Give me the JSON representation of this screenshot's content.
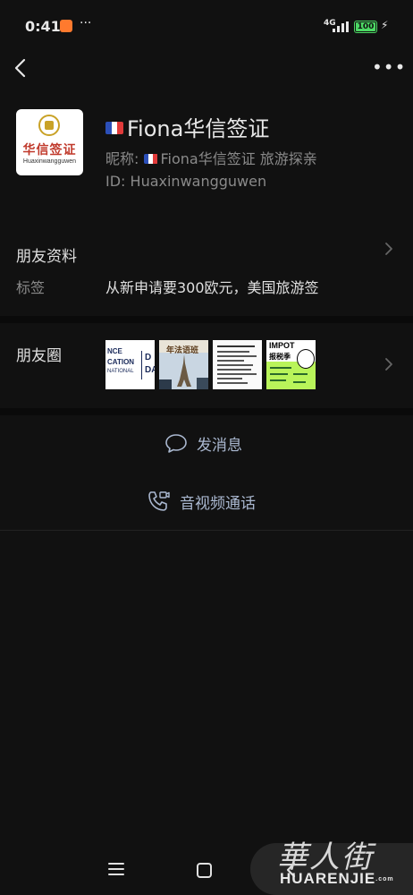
{
  "status_bar": {
    "time": "0:41",
    "dots": "···",
    "network": "4G",
    "battery": "100"
  },
  "profile": {
    "name": "Fiona华信签证",
    "nickname_label": "昵称:",
    "nickname": "Fiona华信签证 旅游探亲",
    "id_label": "ID:",
    "id_value": "Huaxinwangguwen",
    "avatar_title": "华信签证",
    "avatar_subtitle": "Huaxinwangguwen"
  },
  "friend_info": {
    "label": "朋友资料",
    "tag_label": "标签",
    "tag_value": "从新申请要300欧元，美国旅游签"
  },
  "moments": {
    "label": "朋友圈",
    "thumb1_lines": [
      "NCE",
      "CATION",
      "NATIONAL",
      "D",
      "DA"
    ],
    "thumb2_title": "年法语班",
    "thumb4_title": "IMPOT",
    "thumb4_sub": "报税季"
  },
  "actions": {
    "send_message": "发消息",
    "video_call": "音视频通话"
  },
  "watermark": {
    "chinese": "華人街",
    "english": "HUARENJIE",
    "suffix": ".com"
  },
  "icons": {
    "back": "chevron-left-icon",
    "more": "more-horizontal-icon",
    "message": "chat-bubble-icon",
    "call": "video-call-icon"
  }
}
